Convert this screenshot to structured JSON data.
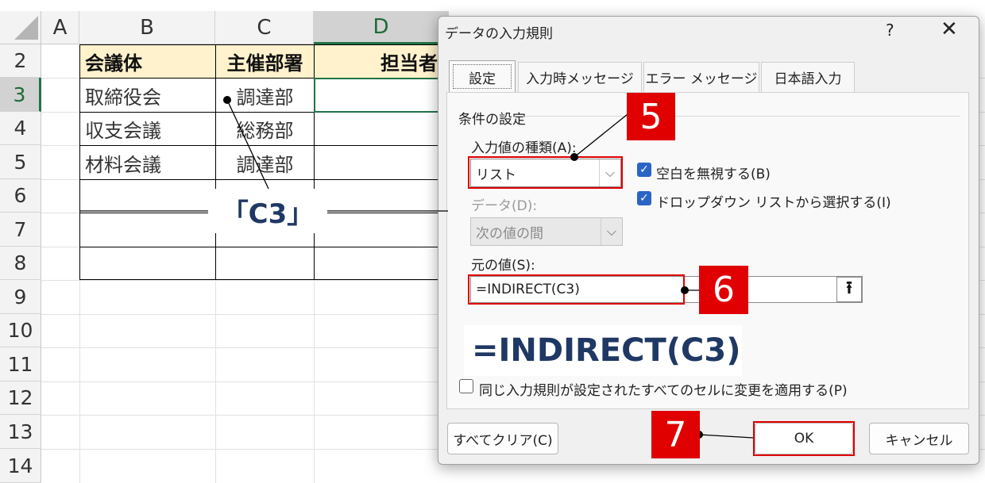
{
  "sheet": {
    "columns": [
      "A",
      "B",
      "C",
      "D"
    ],
    "rows": [
      "2",
      "3",
      "4",
      "5",
      "6",
      "7",
      "8",
      "9",
      "10",
      "11",
      "12",
      "13",
      "14"
    ],
    "headers": {
      "b2": "会議体",
      "c2": "主催部署",
      "d2": "担当者"
    },
    "cells": {
      "b3": "取締役会",
      "c3": "調達部",
      "b4": "収支会議",
      "c4": "総務部",
      "b5": "材料会議",
      "c5": "調達部"
    },
    "callout": "「C3」"
  },
  "dialog": {
    "title": "データの入力規則",
    "help": "?",
    "close": "✕",
    "tabs": [
      "設定",
      "入力時メッセージ",
      "エラー メッセージ",
      "日本語入力"
    ],
    "group_title": "条件の設定",
    "type_label": "入力値の種類(A):",
    "type_value": "リスト",
    "data_label": "データ(D):",
    "data_value": "次の値の間",
    "ignore_blank": "空白を無視する(B)",
    "dropdown": "ドロップダウン リストから選択する(I)",
    "source_label": "元の値(S):",
    "source_value": "=INDIRECT(C3)",
    "formula_display": "=INDIRECT(C3)",
    "apply_all": "同じ入力規則が設定されたすべてのセルに変更を適用する(P)",
    "clear_button": "すべてクリア(C)",
    "ok_button": "OK",
    "cancel_button": "キャンセル"
  },
  "annotations": {
    "step5": "5",
    "step6": "6",
    "step7": "7"
  },
  "colors": {
    "accent_red": "#e00000",
    "excel_green": "#217346",
    "check_blue": "#2a64c5",
    "header_fill": "#fff2cc",
    "formula_navy": "#1f3864"
  }
}
